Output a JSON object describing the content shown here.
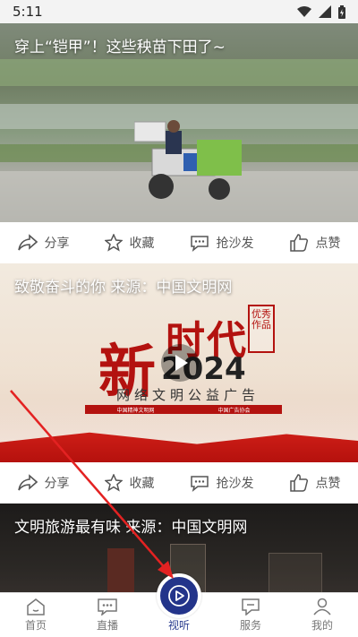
{
  "status_bar": {
    "time": "5:11"
  },
  "feed": [
    {
      "title": "穿上“铠甲”！这些秧苗下田了~",
      "actions": {
        "share": "分享",
        "favorite": "收藏",
        "comment": "抢沙发",
        "like": "点赞"
      }
    },
    {
      "title": "致敬奋斗的你 来源：中国文明网",
      "poster": {
        "xin": "新",
        "shidai": "时代",
        "year": "2024",
        "seal": "优秀作品",
        "banner": "网络文明公益广告",
        "strip_left": "中国精神文明网",
        "strip_right": "中国广告协会"
      },
      "actions": {
        "share": "分享",
        "favorite": "收藏",
        "comment": "抢沙发",
        "like": "点赞"
      }
    },
    {
      "title": "文明旅游最有味 来源：中国文明网"
    }
  ],
  "bottom_nav": [
    {
      "label": "首页",
      "icon": "home-icon"
    },
    {
      "label": "直播",
      "icon": "live-chat-icon"
    },
    {
      "label": "视听",
      "icon": "play-circle-icon",
      "active": true
    },
    {
      "label": "服务",
      "icon": "service-icon"
    },
    {
      "label": "我的",
      "icon": "profile-icon"
    }
  ],
  "colors": {
    "accent": "#23348a",
    "annotation_arrow": "#e32222"
  }
}
